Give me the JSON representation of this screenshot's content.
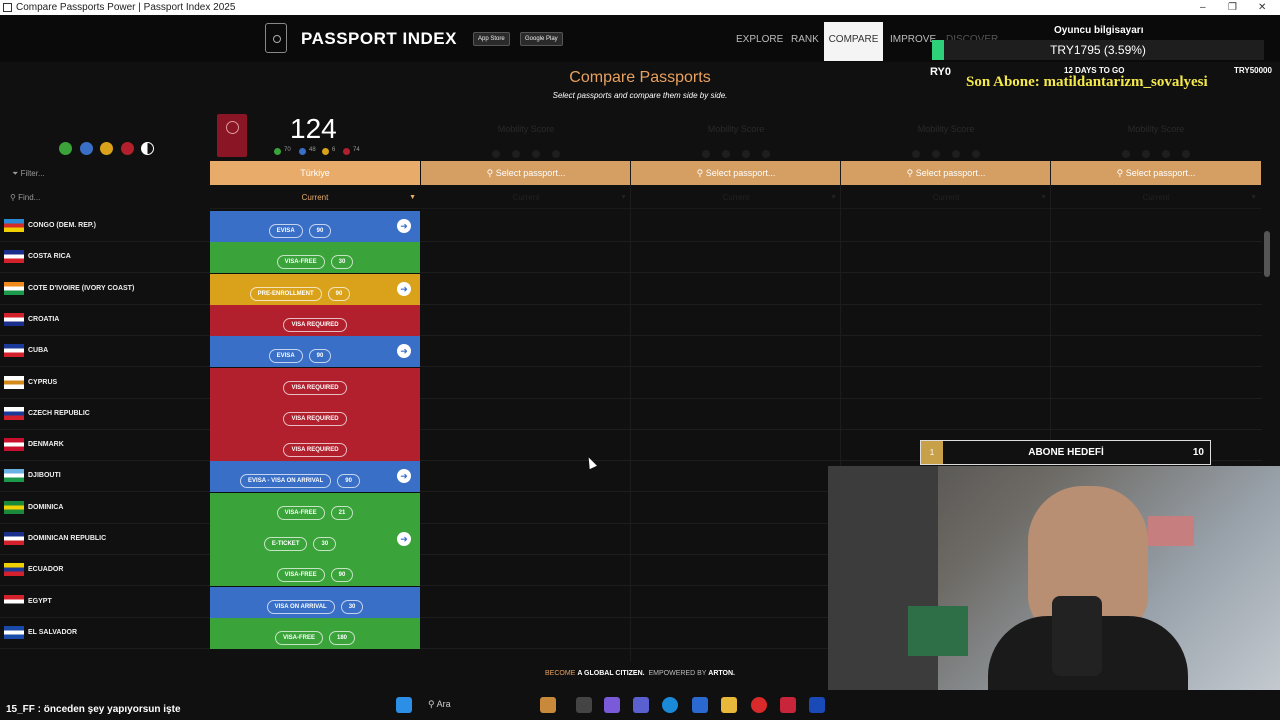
{
  "window": {
    "title": "Compare Passports Power | Passport Index 2025",
    "min": "–",
    "max": "❐",
    "close": "✕"
  },
  "nav": {
    "logo": "PASSPORT INDEX",
    "appstore": "App Store",
    "googleplay": "Google Play",
    "links": [
      "EXPLORE",
      "RANK",
      "COMPARE",
      "IMPROVE",
      "DISCOVER"
    ]
  },
  "header": {
    "title": "Compare Passports",
    "subtitle": "Select passports and compare them side by side."
  },
  "passport": {
    "score": "124",
    "breakdown": [
      {
        "count": "70",
        "color": "#3aa33a"
      },
      {
        "count": "48",
        "color": "#3a6fc7"
      },
      {
        "count": "6",
        "color": "#d9a21a"
      },
      {
        "count": "74",
        "color": "#b21f2d"
      }
    ]
  },
  "filter_dots": [
    "#3aa33a",
    "#3a6fc7",
    "#d9a21a",
    "#b21f2d"
  ],
  "filter_label": "Filter...",
  "find_label": "Find...",
  "columns": {
    "first": {
      "name": "Türkiye",
      "period": "Current"
    },
    "slot_label": "Select passport...",
    "slot_period": "Current",
    "mobility_label": "Mobility Score"
  },
  "countries": [
    {
      "name": "CONGO (DEM. REP.)",
      "status": "EVISA",
      "days": "90",
      "color": "#3a6fc7",
      "go": true,
      "flag": [
        "#2a8ad6",
        "#d42a2a",
        "#f0d000"
      ]
    },
    {
      "name": "COSTA RICA",
      "status": "VISA-FREE",
      "days": "30",
      "color": "#3aa33a",
      "go": false,
      "flag": [
        "#1a2e8c",
        "#ffffff",
        "#d4202a"
      ]
    },
    {
      "name": "COTE D'IVOIRE (IVORY COAST)",
      "status": "PRE-ENROLLMENT",
      "days": "90",
      "color": "#d9a21a",
      "go": true,
      "flag": [
        "#f08a1a",
        "#ffffff",
        "#1a9a4a"
      ]
    },
    {
      "name": "CROATIA",
      "status": "VISA REQUIRED",
      "days": "",
      "color": "#b21f2d",
      "go": false,
      "flag": [
        "#d4202a",
        "#ffffff",
        "#1a2e8c"
      ]
    },
    {
      "name": "CUBA",
      "status": "EVISA",
      "days": "90",
      "color": "#3a6fc7",
      "go": true,
      "flag": [
        "#1a3a9a",
        "#ffffff",
        "#d4202a"
      ]
    },
    {
      "name": "CYPRUS",
      "status": "VISA REQUIRED",
      "days": "",
      "color": "#b21f2d",
      "go": false,
      "flag": [
        "#ffffff",
        "#d48a1a",
        "#ffffff"
      ]
    },
    {
      "name": "CZECH REPUBLIC",
      "status": "VISA REQUIRED",
      "days": "",
      "color": "#b21f2d",
      "go": false,
      "flag": [
        "#ffffff",
        "#1a3a9a",
        "#d4202a"
      ]
    },
    {
      "name": "DENMARK",
      "status": "VISA REQUIRED",
      "days": "",
      "color": "#b21f2d",
      "go": false,
      "flag": [
        "#c8102e",
        "#ffffff",
        "#c8102e"
      ]
    },
    {
      "name": "DJIBOUTI",
      "status": "EVISA - VISA ON ARRIVAL",
      "days": "90",
      "color": "#3a6fc7",
      "go": true,
      "flag": [
        "#6ab2e4",
        "#ffffff",
        "#1a9a4a"
      ]
    },
    {
      "name": "DOMINICA",
      "status": "VISA-FREE",
      "days": "21",
      "color": "#3aa33a",
      "go": false,
      "flag": [
        "#1a8a3a",
        "#f0d000",
        "#1a8a3a"
      ]
    },
    {
      "name": "DOMINICAN REPUBLIC",
      "status": "E-TICKET",
      "days": "30",
      "color": "#3aa33a",
      "go": true,
      "flag": [
        "#1a2e8c",
        "#ffffff",
        "#d4202a"
      ]
    },
    {
      "name": "ECUADOR",
      "status": "VISA-FREE",
      "days": "90",
      "color": "#3aa33a",
      "go": false,
      "flag": [
        "#f0d000",
        "#1a3a9a",
        "#d4202a"
      ]
    },
    {
      "name": "EGYPT",
      "status": "VISA ON ARRIVAL",
      "days": "30",
      "color": "#3a6fc7",
      "go": false,
      "flag": [
        "#d4202a",
        "#ffffff",
        "#111111"
      ]
    },
    {
      "name": "EL SALVADOR",
      "status": "VISA-FREE",
      "days": "180",
      "color": "#3aa33a",
      "go": false,
      "flag": [
        "#1a4aa8",
        "#ffffff",
        "#1a4aa8"
      ]
    }
  ],
  "footer": {
    "part1": "BECOME",
    "part2": "A GLOBAL CITIZEN.",
    "part3": "EMPOWERED BY",
    "part4": "ARTON."
  },
  "overlay": {
    "title": "Oyuncu bilgisayarı",
    "amount": "TRY1795 (3.59%)",
    "left_amount": "RY0",
    "days_to_go": "12 DAYS TO GO",
    "goal_amount": "TRY50000",
    "last_sub": "Son Abone: matildantarizm_sovalyesi",
    "goal_left": "1",
    "goal_label": "ABONE HEDEFİ",
    "goal_right": "10"
  },
  "taskbar": {
    "chat": "15_FF : önceden şey yapıyorsun işte",
    "search": "Ara"
  }
}
